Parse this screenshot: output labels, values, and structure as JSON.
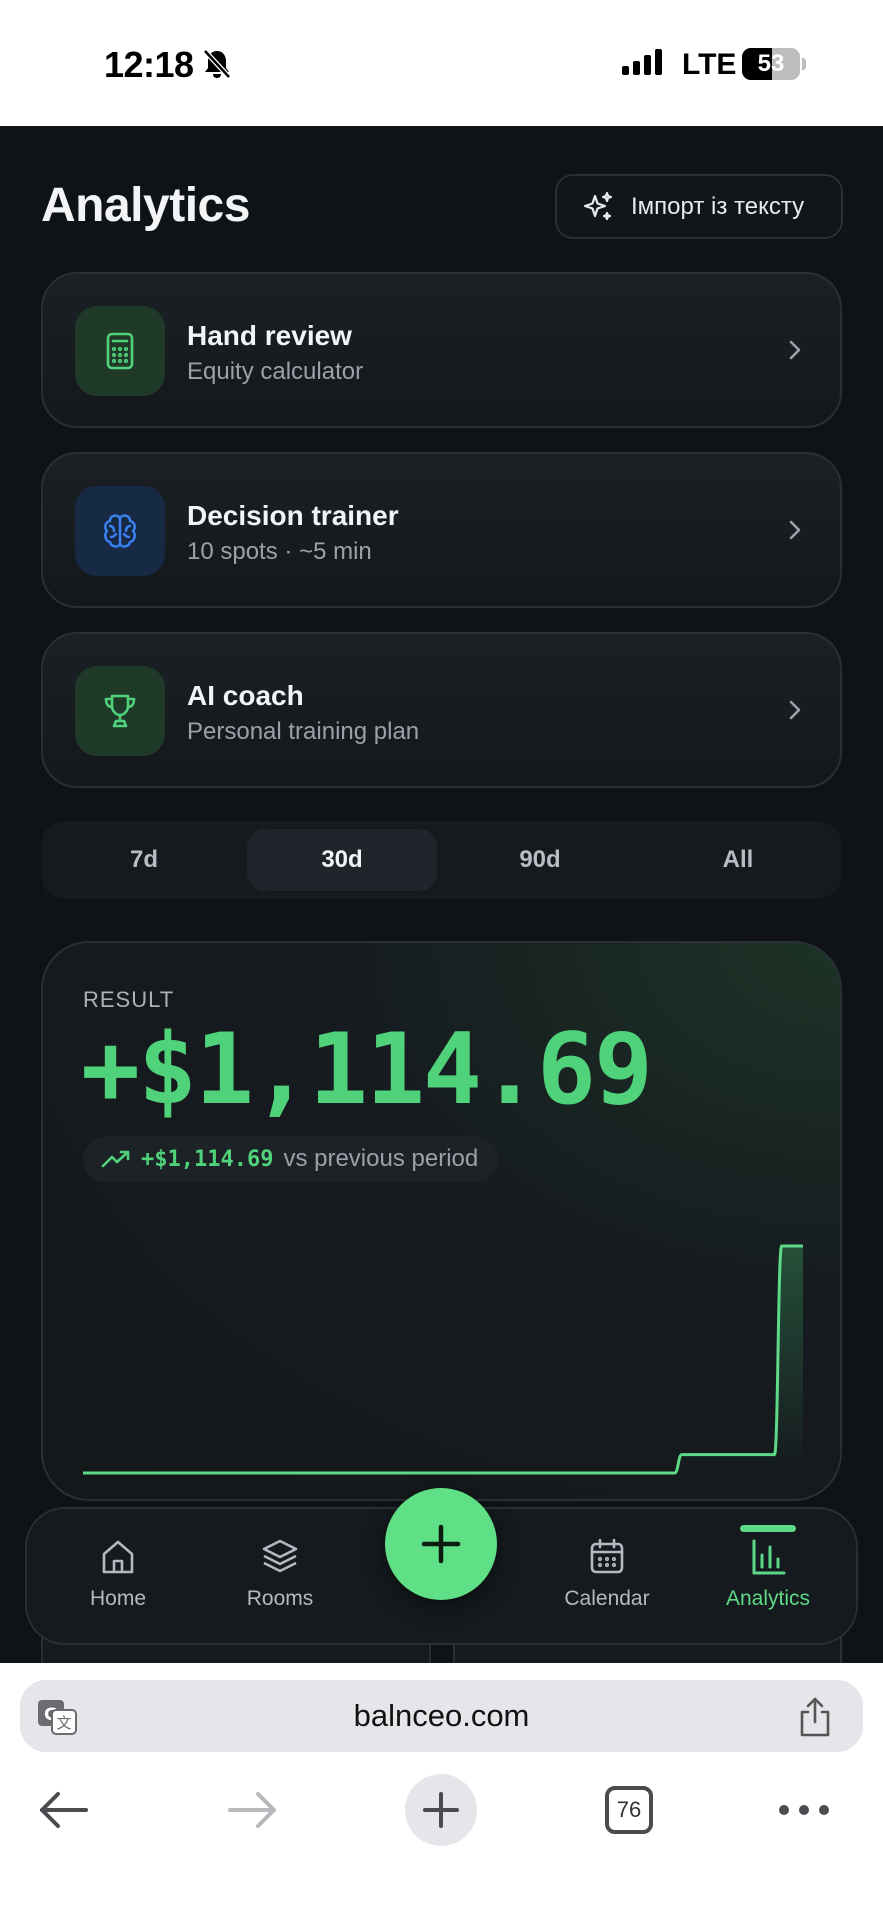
{
  "status_bar": {
    "time": "12:18",
    "network": "LTE",
    "battery": "53"
  },
  "header": {
    "title": "Analytics",
    "import_label": "Імпорт із тексту"
  },
  "cards": [
    {
      "title": "Hand review",
      "subtitle": "Equity calculator",
      "icon": "calculator-icon",
      "accent": "#4fd27a"
    },
    {
      "title": "Decision trainer",
      "subtitle": "10 spots · ~5 min",
      "icon": "brain-icon",
      "accent": "#3b82f6"
    },
    {
      "title": "AI coach",
      "subtitle": "Personal training plan",
      "icon": "trophy-icon",
      "accent": "#4fd27a"
    }
  ],
  "periods": {
    "options": [
      "7d",
      "30d",
      "90d",
      "All"
    ],
    "selected": "30d"
  },
  "result": {
    "label": "RESULT",
    "value": "+$1,114.69",
    "delta": "+$1,114.69",
    "delta_caption": "vs previous period"
  },
  "chart_data": {
    "type": "area",
    "title": "",
    "xlabel": "",
    "ylabel": "",
    "series": [
      {
        "values": [
          0,
          0,
          0,
          0,
          0,
          0,
          0,
          0,
          0,
          0,
          0,
          0,
          0,
          0,
          0,
          0,
          0,
          0,
          0,
          0,
          0,
          0,
          0,
          0,
          0,
          0,
          0,
          0,
          0,
          0,
          0,
          0,
          0,
          0,
          0,
          0,
          0,
          0,
          0,
          0,
          0,
          0,
          0,
          0,
          0,
          0,
          0,
          0,
          0,
          0,
          0,
          0,
          0,
          0,
          0,
          0,
          0,
          0,
          0,
          0,
          0,
          0,
          0,
          0,
          0,
          0,
          0,
          0,
          0,
          0,
          0,
          0,
          0,
          0,
          0,
          0,
          0,
          0,
          0,
          0,
          0,
          0,
          0,
          0,
          90,
          90,
          90,
          90,
          90,
          90,
          90,
          90,
          90,
          90,
          90,
          90,
          90,
          90,
          1114.69,
          1114.69,
          1114.69,
          1114.69
        ]
      }
    ],
    "ylim": [
      0,
      1114.69
    ],
    "grid": false,
    "colors": {
      "line": "#5ed987",
      "fill": "#3fae66"
    }
  },
  "nav": {
    "items": [
      {
        "label": "Home",
        "icon": "home-icon"
      },
      {
        "label": "Rooms",
        "icon": "layers-icon"
      },
      {
        "label": "Calendar",
        "icon": "calendar-icon"
      },
      {
        "label": "Analytics",
        "icon": "bar-chart-icon"
      }
    ],
    "active": "Analytics",
    "fab_icon": "plus-icon"
  },
  "browser": {
    "url": "balnceo.com",
    "tab_count": "76"
  },
  "colors": {
    "accent_green": "#4fd27a",
    "background": "#0f1216",
    "card_border": "#2a2f36"
  }
}
